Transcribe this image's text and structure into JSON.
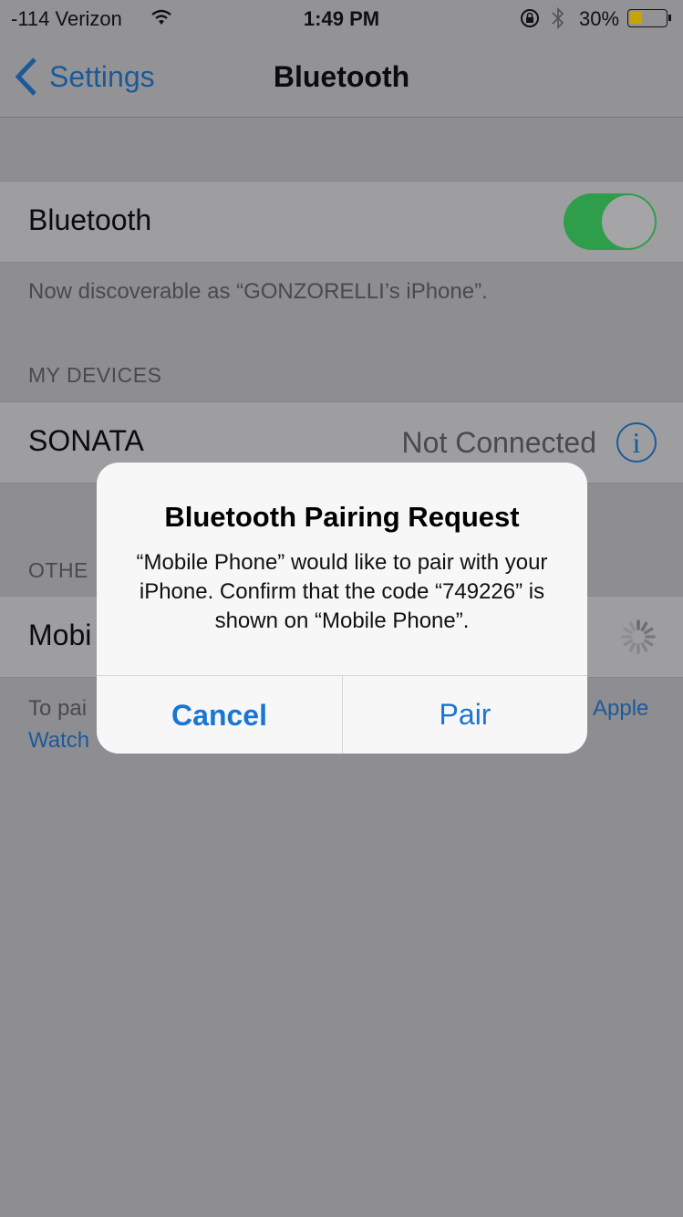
{
  "status_bar": {
    "carrier": "-114 Verizon",
    "time": "1:49 PM",
    "battery": "30%",
    "battery_level": 0.3,
    "icons": [
      "wifi-icon",
      "rotation-lock-icon",
      "bluetooth-icon",
      "battery-icon"
    ]
  },
  "nav": {
    "back_label": "Settings",
    "title": "Bluetooth"
  },
  "bluetooth_toggle": {
    "label": "Bluetooth",
    "on": true,
    "color": "#2f9e4a"
  },
  "discoverable_text": "Now discoverable as “GONZORELLI’s iPhone”.",
  "my_devices": {
    "header": "MY DEVICES",
    "items": [
      {
        "name": "SONATA",
        "status": "Not Connected"
      }
    ]
  },
  "other_devices": {
    "header_visible": "OTHE",
    "item_visible": "Mobi"
  },
  "footer_visible": {
    "left": "To pai",
    "right": "Apple",
    "link": "Watch"
  },
  "alert": {
    "title": "Bluetooth Pairing Request",
    "message": "“Mobile Phone” would like to pair with your iPhone. Confirm that the code “749226” is shown on “Mobile Phone”.",
    "cancel": "Cancel",
    "pair": "Pair"
  }
}
